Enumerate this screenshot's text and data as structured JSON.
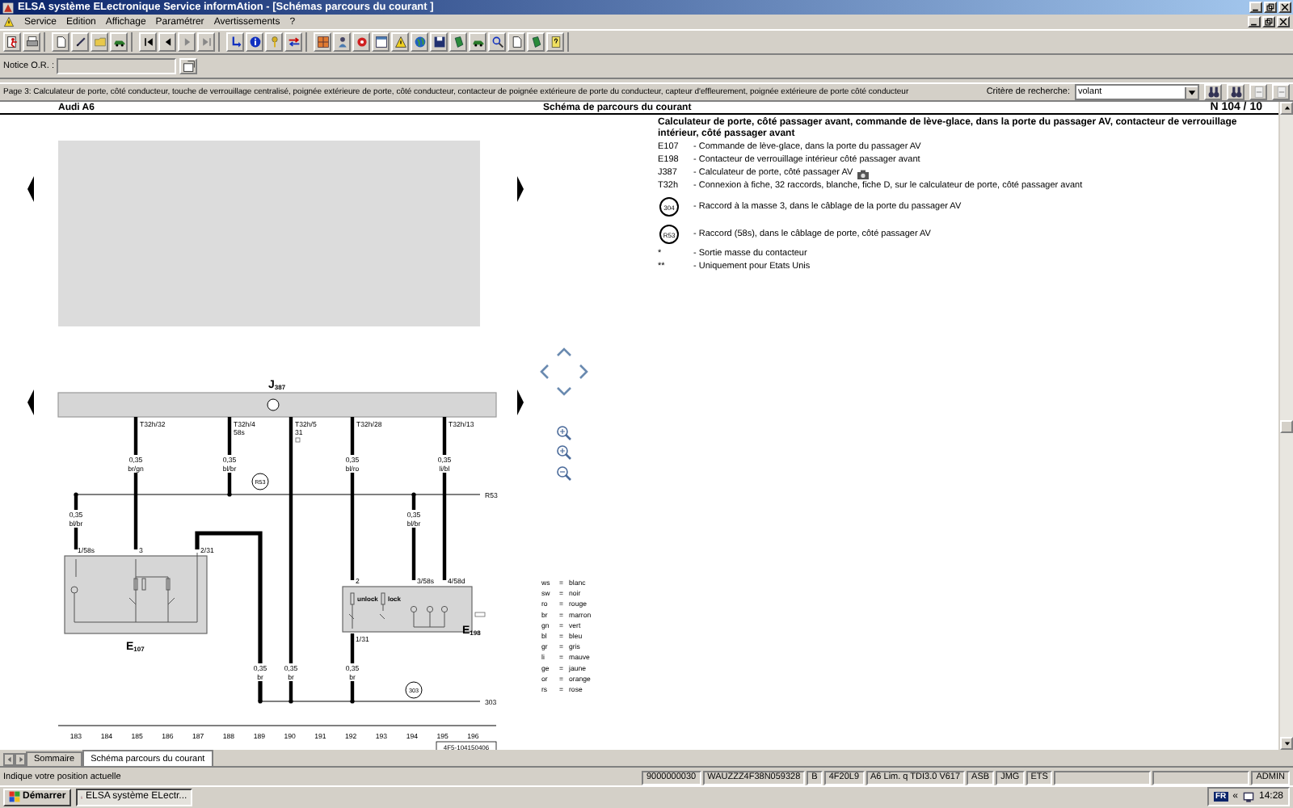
{
  "window": {
    "title": "ELSA système ELectronique Service informAtion - [Schémas parcours du courant ]"
  },
  "menu": [
    "Service",
    "Edition",
    "Affichage",
    "Paramétrer",
    "Avertissements",
    "?"
  ],
  "notice": {
    "label": "Notice O.R. :"
  },
  "page_info": "Page 3: Calculateur de porte, côté conducteur, touche de verrouillage centralisé, poignée extérieure de porte, côté conducteur, contacteur de poignée extérieure de porte du conducteur, capteur d'effleurement, poignée extérieure de porte côté conducteur",
  "search": {
    "label": "Critère de recherche:",
    "value": "volant"
  },
  "document": {
    "header": {
      "left": "Audi A6",
      "center": "Schéma de parcours du courant",
      "right": "N 104 / 10"
    },
    "diagram": {
      "control_unit": {
        "letter": "J",
        "index": "387"
      },
      "connector_pins": [
        {
          "label": "T32h/32"
        },
        {
          "label": "T32h/4",
          "sub": "58s"
        },
        {
          "label": "T32h/5",
          "sub": "31"
        },
        {
          "label": "T32h/28"
        },
        {
          "label": "T32h/13"
        }
      ],
      "wire_labels": [
        {
          "gauge": "0,35",
          "code": "bl/br"
        },
        {
          "gauge": "0,35",
          "code": "br/gn"
        },
        {
          "gauge": "0,35",
          "code": "bl/br"
        },
        {
          "gauge": "0,35",
          "code": "bl/ro"
        },
        {
          "gauge": "0,35",
          "code": "bl/br"
        },
        {
          "gauge": "0,35",
          "code": "li/bl"
        },
        {
          "gauge": "0,35",
          "code": "br"
        },
        {
          "gauge": "0,35",
          "code": "br"
        },
        {
          "gauge": "0,35",
          "code": "br"
        }
      ],
      "components": [
        {
          "letter": "E",
          "index": "107",
          "pins": [
            "1/58s",
            "3",
            "2/31"
          ]
        },
        {
          "letter": "E",
          "index": "198",
          "pins": [
            "2",
            "3/58s",
            "4/58d",
            "1/31"
          ],
          "switch_labels": [
            "unlock",
            "lock"
          ]
        }
      ],
      "splices": [
        {
          "circle": "R53",
          "line_end": "R53"
        },
        {
          "circle": "303",
          "line_end": "303"
        }
      ],
      "columns": [
        "183",
        "184",
        "185",
        "186",
        "187",
        "188",
        "189",
        "190",
        "191",
        "192",
        "193",
        "194",
        "195",
        "196"
      ],
      "drawing_number": "4F5-104150406",
      "legend": [
        {
          "code": "ws",
          "equals": "=",
          "meaning": "blanc"
        },
        {
          "code": "sw",
          "equals": "=",
          "meaning": "noir"
        },
        {
          "code": "ro",
          "equals": "=",
          "meaning": "rouge"
        },
        {
          "code": "br",
          "equals": "=",
          "meaning": "marron"
        },
        {
          "code": "gn",
          "equals": "=",
          "meaning": "vert"
        },
        {
          "code": "bl",
          "equals": "=",
          "meaning": "bleu"
        },
        {
          "code": "gr",
          "equals": "=",
          "meaning": "gris"
        },
        {
          "code": "li",
          "equals": "=",
          "meaning": "mauve"
        },
        {
          "code": "ge",
          "equals": "=",
          "meaning": "jaune"
        },
        {
          "code": "or",
          "equals": "=",
          "meaning": "orange"
        },
        {
          "code": "rs",
          "equals": "=",
          "meaning": "rose"
        }
      ]
    },
    "description": {
      "title": "Calculateur de porte, côté passager avant, commande de lève-glace, dans la porte du passager AV, contacteur de verrouillage intérieur, côté passager avant",
      "items": [
        {
          "kind": "code",
          "code": "E107",
          "text": "- Commande de lève-glace, dans la porte du passager AV"
        },
        {
          "kind": "code",
          "code": "E198",
          "text": "- Contacteur de verrouillage intérieur côté passager avant"
        },
        {
          "kind": "code",
          "code": "J387",
          "text": "- Calculateur de porte, côté passager AV",
          "camera_icon": true
        },
        {
          "kind": "code",
          "code": "T32h",
          "text": "- Connexion à fiche, 32 raccords, blanche, fiche D, sur le calculateur de porte, côté passager avant"
        },
        {
          "kind": "circle",
          "code": "304",
          "text": "- Raccord à la masse 3, dans le câblage de la porte du passager AV"
        },
        {
          "kind": "circle",
          "code": "R53",
          "text": "- Raccord (58s), dans le câblage de porte, côté passager AV"
        },
        {
          "kind": "code",
          "code": "*",
          "text": "- Sortie masse du contacteur"
        },
        {
          "kind": "code",
          "code": "**",
          "text": "- Uniquement pour Etats Unis"
        }
      ]
    }
  },
  "tabs": [
    {
      "label": "Sommaire",
      "selected": false
    },
    {
      "label": "Schéma parcours du courant",
      "selected": true
    }
  ],
  "status_bar": {
    "message": "Indique votre position actuelle",
    "fields": [
      "9000000030",
      "WAUZZZ4F38N059328",
      "B",
      "4F20L9",
      "A6 Lim. q TDI3.0 V617",
      "ASB",
      "JMG",
      "ETS"
    ],
    "user": "ADMIN"
  },
  "taskbar": {
    "start": "Démarrer",
    "tasks": [
      {
        "label": "ELSA système ELectr...",
        "selected": true
      }
    ],
    "language": "FR",
    "tray_toggle": "«",
    "clock": "14:28"
  }
}
